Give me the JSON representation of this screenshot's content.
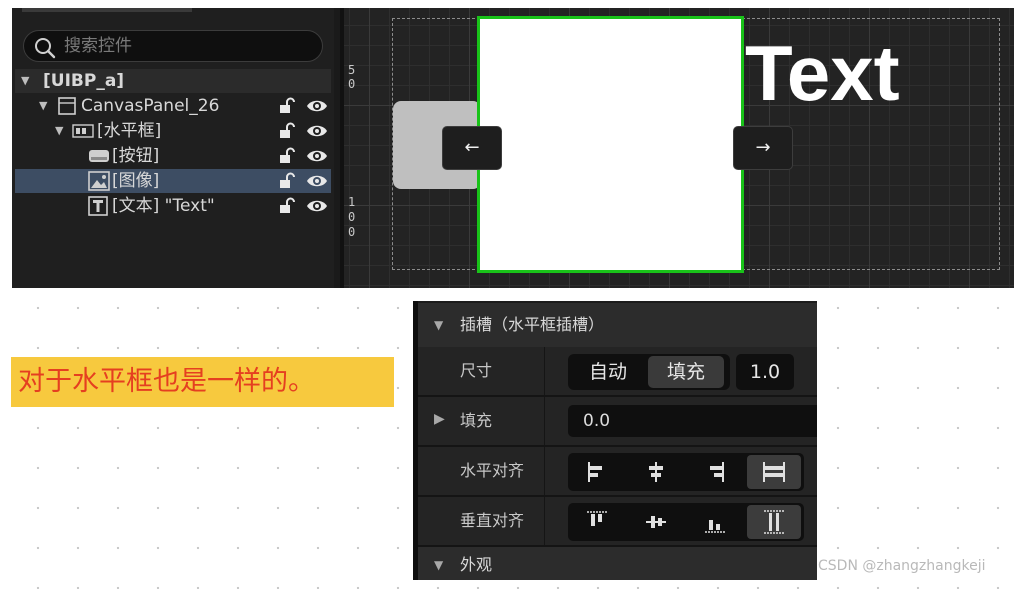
{
  "hierarchy": {
    "search": {
      "placeholder": "搜索控件",
      "value": ""
    },
    "root": {
      "label": "[UIBP_a]"
    },
    "nodes": [
      {
        "label": "CanvasPanel_26",
        "icon": "canvas-panel-icon"
      },
      {
        "label": "[水平框]",
        "icon": "horizontal-box-icon"
      },
      {
        "label": "[按钮]",
        "icon": "button-widget-icon"
      },
      {
        "label": "[图像]",
        "icon": "image-widget-icon",
        "selected": true
      },
      {
        "label": "[文本] \"Text\"",
        "icon": "text-widget-icon"
      }
    ]
  },
  "viewport": {
    "ruler_labels": [
      "5",
      "0",
      "1",
      "0",
      "0"
    ],
    "arrow_left": "←",
    "arrow_right": "→",
    "text_widget": "Text",
    "selection_color": "#19c319"
  },
  "note": {
    "text": "对于水平框也是一样的。",
    "background": "#f7c93e",
    "color": "#e53f20"
  },
  "details": {
    "slot_header": "插槽（水平框插槽）",
    "size": {
      "label": "尺寸",
      "options": [
        "自动",
        "填充"
      ],
      "selected": "填充",
      "value": "1.0"
    },
    "padding": {
      "label": "填充",
      "value": "0.0"
    },
    "horizontal_alignment": {
      "label": "水平对齐",
      "options": [
        "align-left-icon",
        "align-center-horizontal-icon",
        "align-right-icon",
        "fill-horizontal-icon"
      ],
      "selected": "fill-horizontal-icon"
    },
    "vertical_alignment": {
      "label": "垂直对齐",
      "options": [
        "align-top-icon",
        "align-center-vertical-icon",
        "align-bottom-icon",
        "fill-vertical-icon"
      ],
      "selected": "fill-vertical-icon"
    },
    "appearance_header": "外观"
  },
  "watermark": "CSDN @zhangzhangkeji"
}
